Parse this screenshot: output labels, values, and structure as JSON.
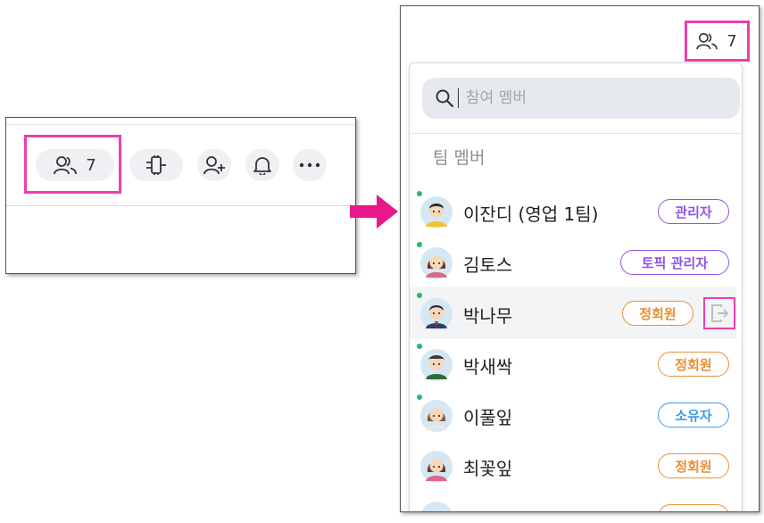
{
  "toolbar": {
    "member_count": "7"
  },
  "search": {
    "placeholder": "참여 멤버"
  },
  "section_title": "팀 멤버",
  "members": [
    {
      "name": "이잔디 (영업 1팀)",
      "role": "관리자",
      "online": true
    },
    {
      "name": "김토스",
      "role": "토픽 관리자",
      "online": true
    },
    {
      "name": "박나무",
      "role": "정회원",
      "online": true
    },
    {
      "name": "박새싹",
      "role": "정회원",
      "online": true
    },
    {
      "name": "이풀잎",
      "role": "소유자",
      "online": true
    },
    {
      "name": "최꽃잎",
      "role": "정회원",
      "online": false
    }
  ],
  "colors": {
    "highlight": "#ec3fac",
    "admin": "#8e54e9",
    "member": "#e69138",
    "owner": "#3d9be9",
    "online": "#2bb673"
  }
}
